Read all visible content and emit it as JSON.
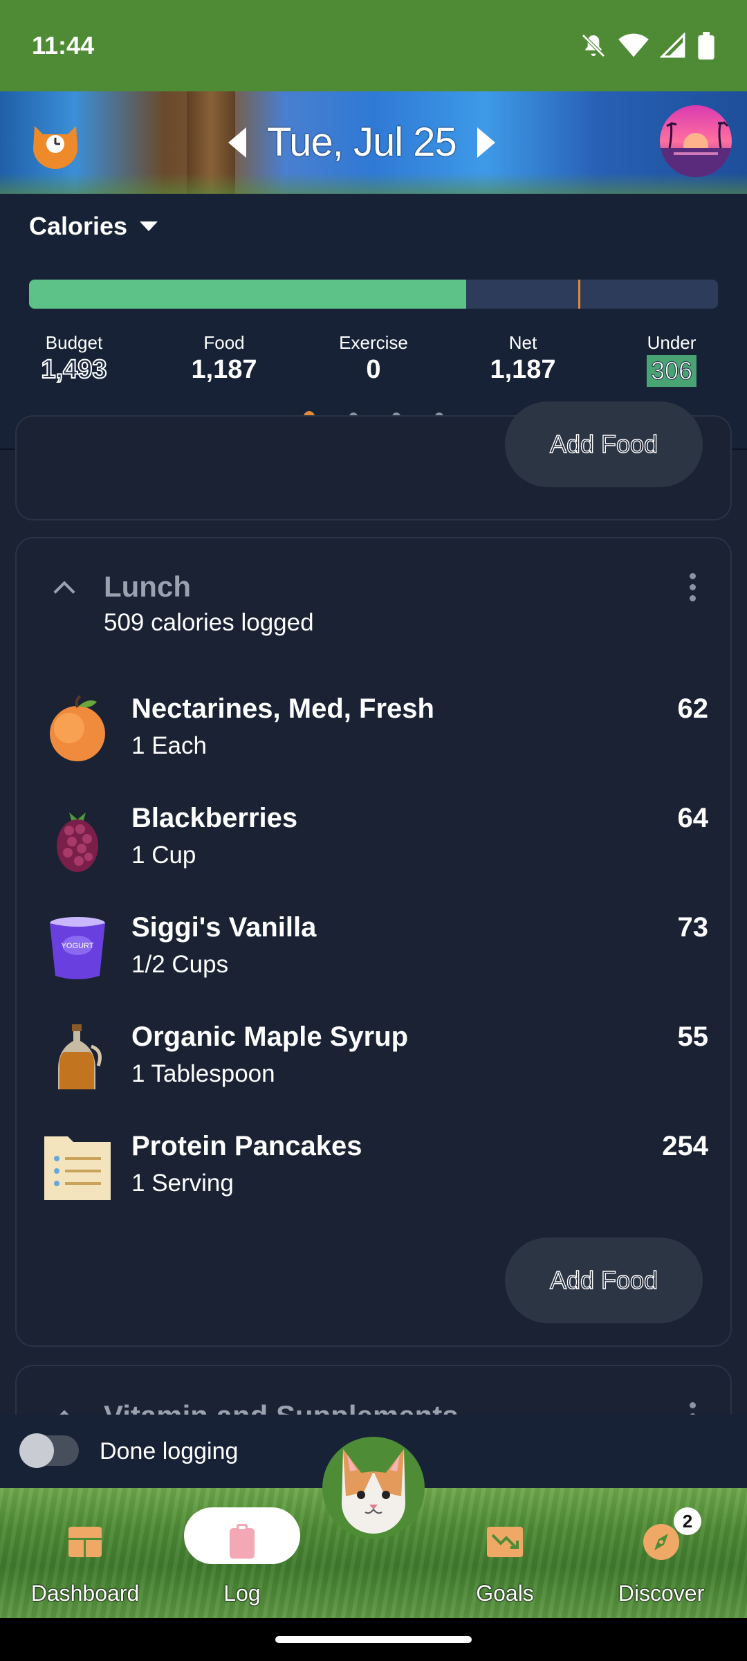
{
  "status_bar": {
    "time": "11:44",
    "icons": [
      "do-not-disturb-icon",
      "wifi-icon",
      "signal-icon",
      "battery-icon"
    ]
  },
  "header": {
    "date": "Tue, Jul 25",
    "prev_icon": "arrow-left-icon",
    "next_icon": "arrow-right-icon"
  },
  "summary": {
    "selector_label": "Calories",
    "progress_fraction": 0.635,
    "marker_fraction": 0.797,
    "stats": [
      {
        "label": "Budget",
        "value": "1,493"
      },
      {
        "label": "Food",
        "value": "1,187"
      },
      {
        "label": "Exercise",
        "value": "0"
      },
      {
        "label": "Net",
        "value": "1,187"
      },
      {
        "label": "Under",
        "value": "306"
      }
    ],
    "page_count": 4,
    "active_page": 1
  },
  "previous_meal": {
    "add_label": "Add Food"
  },
  "lunch": {
    "title": "Lunch",
    "subtitle": "509 calories logged",
    "items": [
      {
        "name": "Nectarines, Med, Fresh",
        "qty": "1 Each",
        "cal": "62",
        "icon": "nectarine-icon"
      },
      {
        "name": "Blackberries",
        "qty": "1 Cup",
        "cal": "64",
        "icon": "blackberry-icon"
      },
      {
        "name": "Siggi's Vanilla",
        "qty": "1/2 Cups",
        "cal": "73",
        "icon": "yogurt-icon"
      },
      {
        "name": "Organic Maple Syrup",
        "qty": "1 Tablespoon",
        "cal": "55",
        "icon": "syrup-bottle-icon"
      },
      {
        "name": "Protein Pancakes",
        "qty": "1 Serving",
        "cal": "254",
        "icon": "recipe-card-icon"
      }
    ],
    "add_label": "Add Food"
  },
  "next_meal": {
    "title": "Vitamin and Supplements"
  },
  "done_logging": {
    "label": "Done logging",
    "checked": false
  },
  "bottom_nav": {
    "items": [
      {
        "label": "Dashboard",
        "icon": "dashboard-icon"
      },
      {
        "label": "Log",
        "icon": "clipboard-icon"
      },
      {
        "label": "Goals",
        "icon": "goals-chart-icon"
      },
      {
        "label": "Discover",
        "icon": "compass-icon",
        "badge": "2"
      }
    ]
  },
  "colors": {
    "status_green": "#4f8a34",
    "panel": "#172236",
    "card": "#1a2233",
    "progress_green": "#5dc287",
    "accent_orange": "#e38a3a"
  }
}
